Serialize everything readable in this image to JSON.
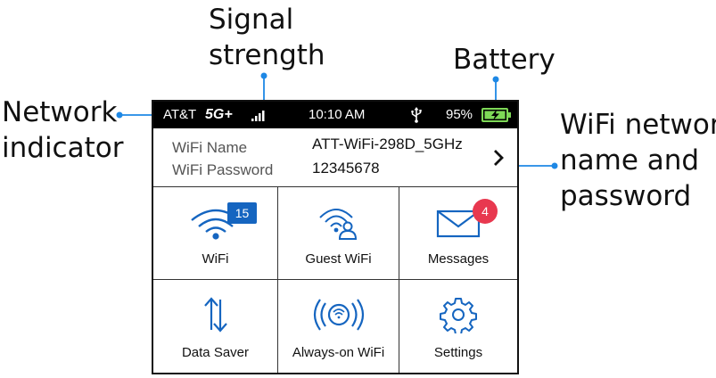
{
  "callouts": {
    "signal_line1": "Signal",
    "signal_line2": "strength",
    "battery": "Battery",
    "network_line1": "Network",
    "network_line2": "indicator",
    "wifi_line1": "WiFi network",
    "wifi_line2": "name and",
    "wifi_line3": "password"
  },
  "status_bar": {
    "carrier": "AT&T",
    "network_type": "5G+",
    "time": "10:10 AM",
    "battery_percent": "95%",
    "signal_bars": 4,
    "icons": [
      "signal-bars-icon",
      "usb-icon",
      "battery-charging-icon"
    ]
  },
  "wifi_info": {
    "name_label": "WiFi Name",
    "name_value": "ATT-WiFi-298D_5GHz",
    "password_label": "WiFi Password",
    "password_value": "12345678",
    "chevron_icon": "chevron-right-icon"
  },
  "tiles": [
    {
      "label": "WiFi",
      "icon": "wifi-icon",
      "badge": "15"
    },
    {
      "label": "Guest WiFi",
      "icon": "guest-wifi-icon"
    },
    {
      "label": "Messages",
      "icon": "envelope-icon",
      "badge": "4"
    },
    {
      "label": "Data Saver",
      "icon": "data-saver-icon"
    },
    {
      "label": "Always-on WiFi",
      "icon": "always-on-wifi-icon"
    },
    {
      "label": "Settings",
      "icon": "gear-icon"
    }
  ],
  "colors": {
    "accent_blue": "#1565c0",
    "badge_red": "#e8384f",
    "battery_green": "#7ed957",
    "callout_line": "#1e88e5"
  }
}
